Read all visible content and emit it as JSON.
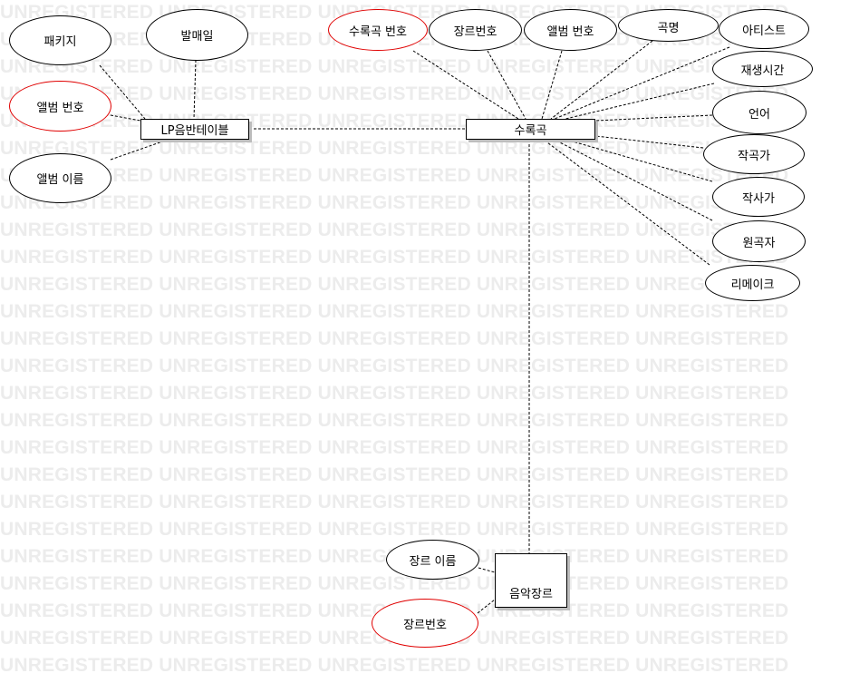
{
  "watermark": "UNREGISTERED UNREGISTERED UNREGISTERED UNREGISTERED UNREGISTERED",
  "entities": {
    "lp": "LP음반테이블",
    "track": "수록곡",
    "genre": "음악장르"
  },
  "lp_attributes": {
    "package": "패키지",
    "release_date": "발매일",
    "album_no": "앨범 번호",
    "album_name": "앨범 이름"
  },
  "track_attributes": {
    "track_no": "수록곡 번호",
    "genre_no": "장르번호",
    "album_no": "앨범 번호",
    "title": "곡명",
    "artist": "아티스트",
    "play_time": "재생시간",
    "language": "언어",
    "composer": "작곡가",
    "lyricist": "작사가",
    "original_composer": "원곡자",
    "remake": "리메이크"
  },
  "genre_attributes": {
    "genre_name": "장르 이름",
    "genre_no": "장르번호"
  },
  "colors": {
    "key_attribute_border": "#e00000",
    "line": "#000000"
  }
}
